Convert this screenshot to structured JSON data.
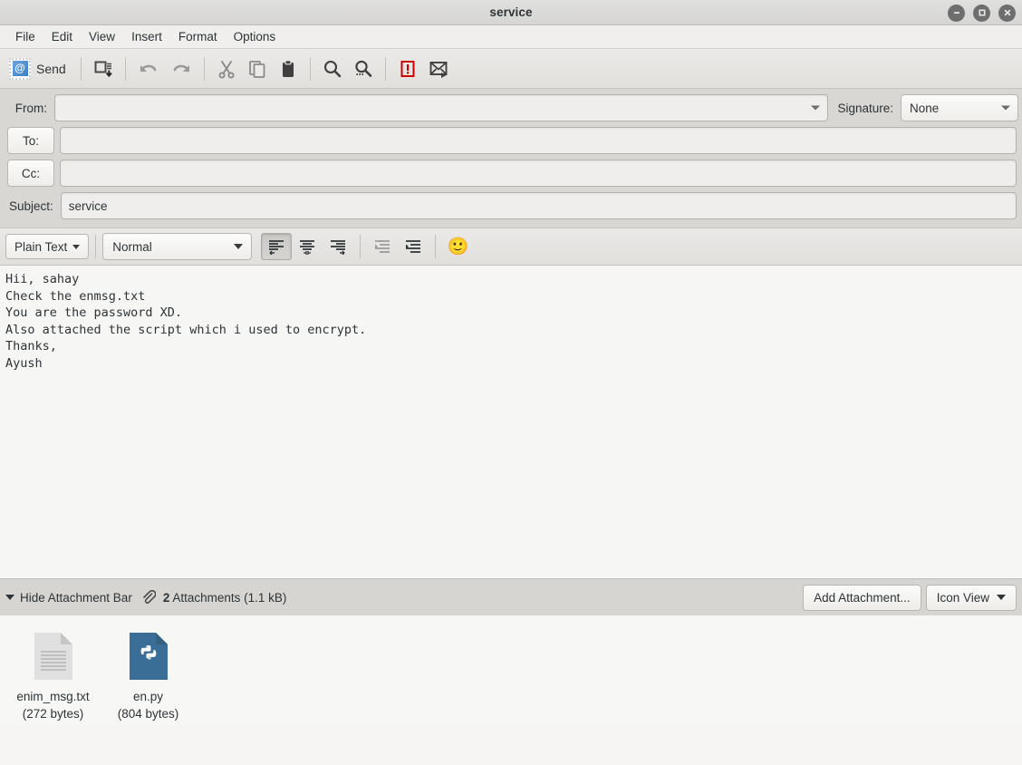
{
  "window": {
    "title": "service",
    "controls": [
      {
        "name": "minimize",
        "glyph": "−"
      },
      {
        "name": "maximize",
        "glyph": "□"
      },
      {
        "name": "close",
        "glyph": "×"
      }
    ]
  },
  "menubar": {
    "items": [
      {
        "label": "File"
      },
      {
        "label": "Edit"
      },
      {
        "label": "View"
      },
      {
        "label": "Insert"
      },
      {
        "label": "Format"
      },
      {
        "label": "Options"
      }
    ]
  },
  "toolbar": {
    "send_label": "Send",
    "send_icon": "stamp-at-icon",
    "items": [
      {
        "icon": "save-draft-icon",
        "label": "Save"
      },
      {
        "icon": "undo-icon",
        "label": "Undo"
      },
      {
        "icon": "redo-icon",
        "label": "Redo"
      },
      {
        "icon": "cut-icon",
        "label": "Cut"
      },
      {
        "icon": "copy-icon",
        "label": "Copy"
      },
      {
        "icon": "paste-icon",
        "label": "Paste"
      },
      {
        "icon": "spellcheck-icon",
        "label": "Spelling"
      },
      {
        "icon": "find-icon",
        "label": "Find"
      },
      {
        "icon": "priority-icon",
        "label": "Priority"
      },
      {
        "icon": "receipt-icon",
        "label": "Return Receipt"
      }
    ]
  },
  "headers": {
    "from_label": "From:",
    "from_value": "",
    "signature_label": "Signature:",
    "signature_value": "None",
    "to_label": "To:",
    "to_value": "",
    "cc_label": "Cc:",
    "cc_value": "",
    "subject_label": "Subject:",
    "subject_value": "service"
  },
  "format_bar": {
    "format_mode": "Plain Text",
    "paragraph_style": "Normal",
    "align_left": "align-left",
    "align_center": "align-center",
    "align_right": "align-right",
    "outdent": "outdent",
    "indent": "indent",
    "emoji": "🙂",
    "active_alignment": "align-left"
  },
  "body": {
    "text": "Hii, sahay\nCheck the enmsg.txt\nYou are the password XD.\nAlso attached the script which i used to encrypt.\nThanks,\nAyush"
  },
  "attachment_bar": {
    "hide_label": "Hide Attachment Bar",
    "count": "2",
    "count_suffix": "Attachments (1.1 kB)",
    "add_label": "Add Attachment...",
    "view_label": "Icon View"
  },
  "attachments": [
    {
      "name": "enim_msg.txt",
      "size": "(272 bytes)",
      "kind": "text"
    },
    {
      "name": "en.py",
      "size": "(804 bytes)",
      "kind": "python"
    }
  ],
  "colors": {
    "titlebar": "#dcdbd9",
    "toolbar": "#e7e5e2",
    "header_bg": "#d9d7d4",
    "body_bg": "#f6f6f5",
    "attachment_bar": "#d6d5d2",
    "python_icon": "#3b6e96",
    "priority_red": "#cc0000"
  }
}
